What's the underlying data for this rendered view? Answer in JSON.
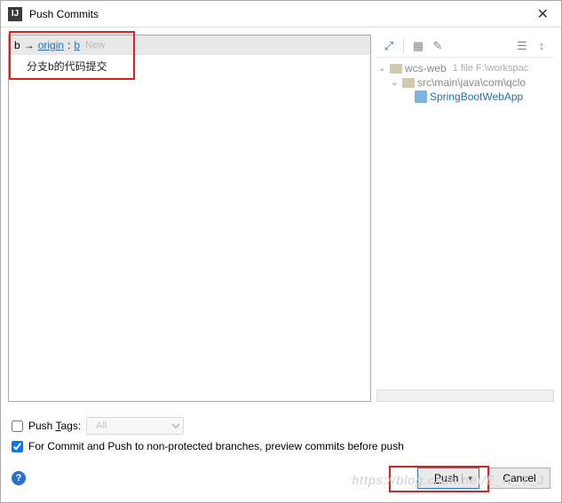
{
  "titlebar": {
    "icon_text": "IJ",
    "title": "Push Commits",
    "close": "✕"
  },
  "branch": {
    "local": "b",
    "arrow": "→",
    "remote": "origin",
    "colon": ":",
    "remote_branch": "b",
    "new_badge": "New"
  },
  "commit": {
    "message": "分支b的代码提交"
  },
  "toolbar": {
    "expand": "⤢",
    "grid": "▦",
    "edit": "✎",
    "collapse": "☰",
    "settings": "↕"
  },
  "tree": {
    "root": {
      "name": "wcs-web",
      "info": "1 file  F:\\workspac"
    },
    "folder": {
      "name": "src\\main\\java\\com\\qclo"
    },
    "file": {
      "name": "SpringBootWebApp"
    }
  },
  "options": {
    "push_tags_label": "Push Tags:",
    "push_tags_placeholder": "All",
    "preview_label": "For Commit and Push to non-protected branches, preview commits before push"
  },
  "buttons": {
    "help": "?",
    "push": "Push",
    "dropdown": "▾",
    "cancel": "Cancel"
  },
  "watermark": "https://blog.csdn.net/E_N_T_J"
}
